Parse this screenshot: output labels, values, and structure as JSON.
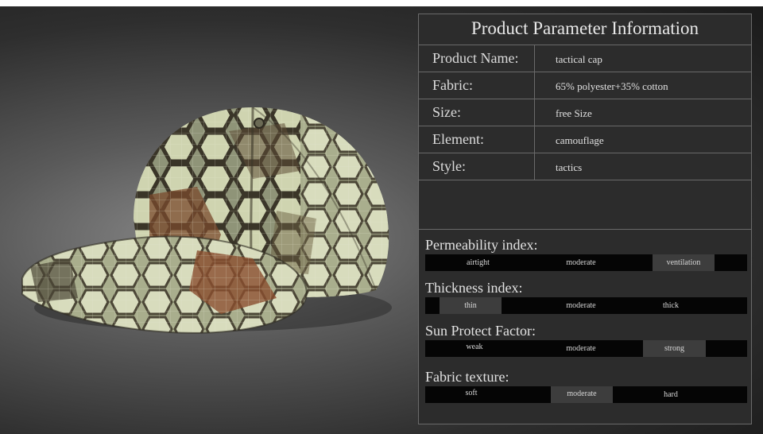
{
  "table": {
    "title": "Product Parameter Information",
    "rows": [
      {
        "label": "Product Name:",
        "value": "tactical cap"
      },
      {
        "label": "Fabric:",
        "value": "65% polyester+35% cotton"
      },
      {
        "label": "Size:",
        "value": "free Size"
      },
      {
        "label": "Element:",
        "value": "camouflage"
      },
      {
        "label": "Style:",
        "value": "tactics"
      }
    ]
  },
  "indices": [
    {
      "title": "Permeability index:",
      "levels": [
        "airtight",
        "moderate",
        "ventilation"
      ],
      "selected": "ventilation"
    },
    {
      "title": "Thickness index:",
      "levels": [
        "thin",
        "moderate",
        "thick"
      ],
      "selected": "thin"
    },
    {
      "title": "Sun Protect Factor:",
      "levels": [
        "weak",
        "moderate",
        "strong"
      ],
      "selected": "strong"
    },
    {
      "title": "Fabric texture:",
      "levels": [
        "soft",
        "moderate",
        "hard"
      ],
      "selected": "moderate"
    }
  ],
  "colors": {
    "background": "#2e2e2e",
    "panel": "#2c2c2c",
    "bar": "#050505",
    "highlight": "#3d3d3d",
    "border": "#6a6a6a"
  }
}
